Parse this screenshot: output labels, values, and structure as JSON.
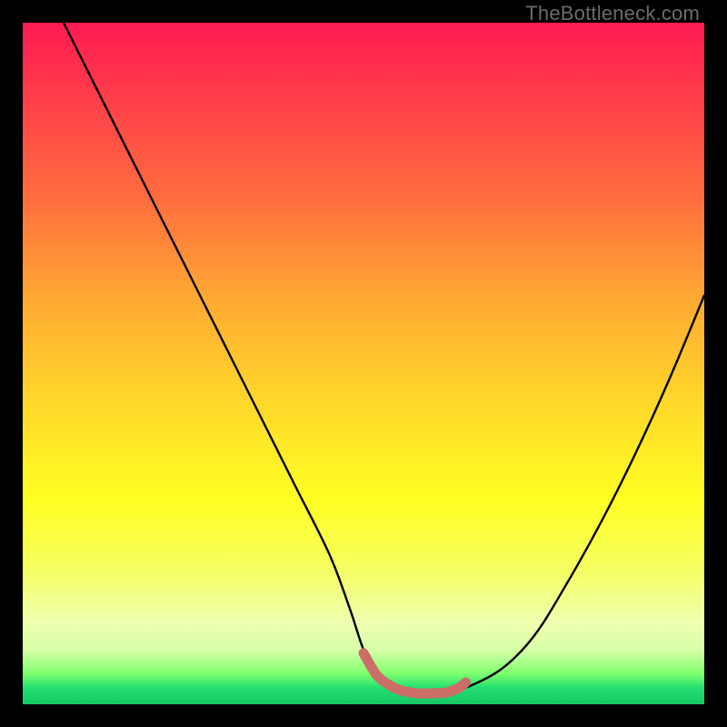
{
  "watermark": "TheBottleneck.com",
  "chart_data": {
    "type": "line",
    "title": "",
    "xlabel": "",
    "ylabel": "",
    "xlim": [
      0,
      100
    ],
    "ylim": [
      0,
      100
    ],
    "annotations": [],
    "series": [
      {
        "name": "bottleneck-curve",
        "x": [
          6,
          10,
          15,
          20,
          25,
          30,
          35,
          40,
          45,
          48,
          50,
          52,
          55,
          58,
          60,
          62,
          64,
          70,
          75,
          80,
          85,
          90,
          95,
          100
        ],
        "y": [
          100,
          92,
          82,
          72,
          62,
          52,
          42,
          32,
          22,
          14,
          8,
          4,
          2,
          1.5,
          1.5,
          1.5,
          2,
          5,
          10,
          18,
          27,
          37,
          48,
          60
        ]
      },
      {
        "name": "optimal-range-marker",
        "x": [
          50,
          52,
          54,
          55,
          56,
          58,
          60,
          62,
          63,
          64,
          65
        ],
        "y": [
          7.5,
          4.2,
          2.7,
          2.2,
          1.9,
          1.6,
          1.6,
          1.7,
          2.0,
          2.4,
          3.2
        ]
      }
    ],
    "gradient_stops": [
      {
        "offset": 0.0,
        "color": "#ff1a52"
      },
      {
        "offset": 0.1,
        "color": "#ff3a4a"
      },
      {
        "offset": 0.25,
        "color": "#ff6a3f"
      },
      {
        "offset": 0.4,
        "color": "#ffa733"
      },
      {
        "offset": 0.55,
        "color": "#ffd62a"
      },
      {
        "offset": 0.7,
        "color": "#ffff22"
      },
      {
        "offset": 0.8,
        "color": "#f6ff60"
      },
      {
        "offset": 0.88,
        "color": "#efffb0"
      },
      {
        "offset": 0.92,
        "color": "#d8ffa8"
      },
      {
        "offset": 0.955,
        "color": "#7fff6e"
      },
      {
        "offset": 0.975,
        "color": "#25e070"
      },
      {
        "offset": 1.0,
        "color": "#14c862"
      }
    ]
  }
}
